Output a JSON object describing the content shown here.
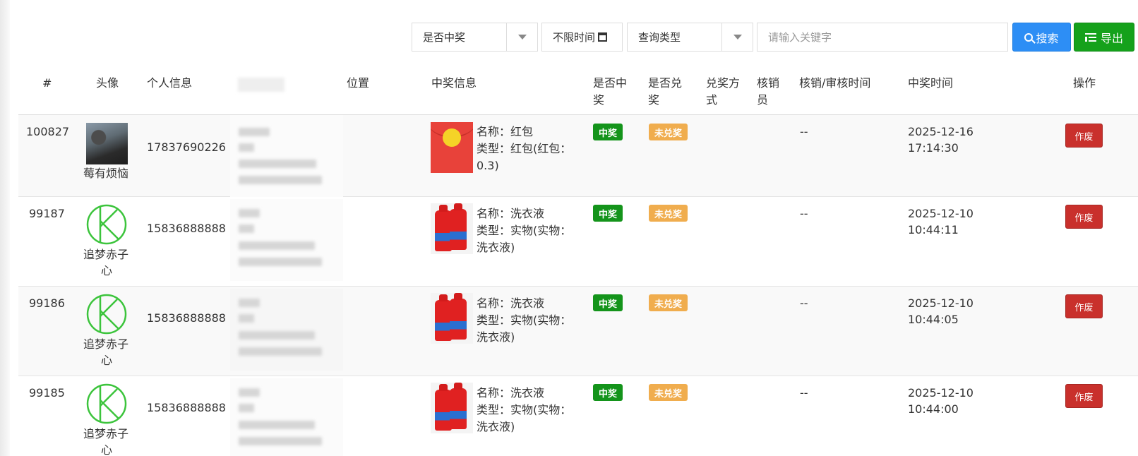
{
  "toolbar": {
    "is_won_select": "是否中奖",
    "time_filter": "不限时间",
    "query_type_select": "查询类型",
    "keyword_placeholder": "请输入关键字",
    "search_label": "搜索",
    "export_label": "导出"
  },
  "table": {
    "headers": {
      "id": "#",
      "avatar": "头像",
      "personal_info": "个人信息",
      "location": "位置",
      "prize_info": "中奖信息",
      "is_won": "是否中奖",
      "is_redeemed": "是否兑奖",
      "redeem_method": "兑奖方式",
      "verifier": "核销员",
      "verify_time": "核销/审核时间",
      "won_time": "中奖时间",
      "actions": "操作"
    },
    "rows": [
      {
        "id": "100827",
        "avatar_type": "photo",
        "nickname": "莓有烦恼",
        "phone": "17837690226",
        "prize_image": "red-envelope",
        "prize_name": "名称：红包",
        "prize_type_line1": "类型：红包(红包：",
        "prize_type_line2": "0.3)",
        "won_badge": "中奖",
        "redeem_badge": "未兑奖",
        "verify_time": "--",
        "won_date": "2025-12-16",
        "won_clock": "17:14:30",
        "action": "作废"
      },
      {
        "id": "99187",
        "avatar_type": "k-logo",
        "nickname_line1": "追梦赤子",
        "nickname_line2": "心",
        "phone": "15836888888",
        "prize_image": "detergent-bottles",
        "prize_name": "名称：洗衣液",
        "prize_type_line1": "类型：实物(实物：",
        "prize_type_line2": "洗衣液)",
        "won_badge": "中奖",
        "redeem_badge": "未兑奖",
        "verify_time": "--",
        "won_date": "2025-12-10",
        "won_clock": "10:44:11",
        "action": "作废"
      },
      {
        "id": "99186",
        "avatar_type": "k-logo",
        "nickname_line1": "追梦赤子",
        "nickname_line2": "心",
        "phone": "15836888888",
        "prize_image": "detergent-bottles",
        "prize_name": "名称：洗衣液",
        "prize_type_line1": "类型：实物(实物：",
        "prize_type_line2": "洗衣液)",
        "won_badge": "中奖",
        "redeem_badge": "未兑奖",
        "verify_time": "--",
        "won_date": "2025-12-10",
        "won_clock": "10:44:05",
        "action": "作废"
      },
      {
        "id": "99185",
        "avatar_type": "k-logo",
        "nickname_line1": "追梦赤子",
        "nickname_line2": "心",
        "phone": "15836888888",
        "prize_image": "detergent-bottles",
        "prize_name": "名称：洗衣液",
        "prize_type_line1": "类型：实物(实物：",
        "prize_type_line2": "洗衣液)",
        "won_badge": "中奖",
        "redeem_badge": "未兑奖",
        "verify_time": "--",
        "won_date": "2025-12-10",
        "won_clock": "10:44:00",
        "action": "作废"
      }
    ]
  },
  "colors": {
    "search_button": "#2d8ef5",
    "export_button": "#15a11b",
    "won_badge": "#14941b",
    "unredeemed_badge": "#f0ad4e",
    "void_button": "#c9302c",
    "k_logo": "#3cc43c"
  },
  "icons": {
    "search": "search-icon",
    "export": "list-icon",
    "calendar": "calendar-icon",
    "dropdown": "caret-down-icon"
  }
}
